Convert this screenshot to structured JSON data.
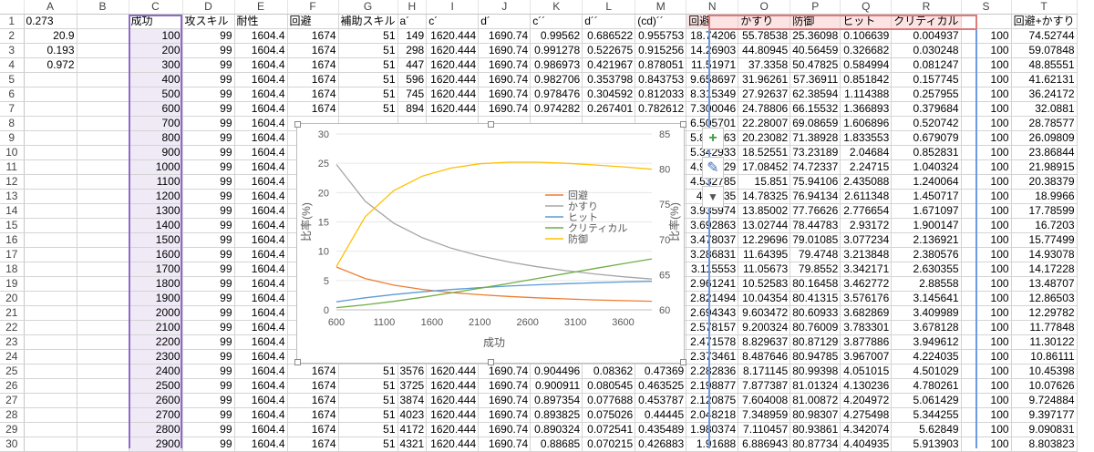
{
  "columns": [
    "A",
    "B",
    "C",
    "D",
    "E",
    "F",
    "G",
    "H",
    "I",
    "J",
    "K",
    "L",
    "M",
    "N",
    "O",
    "P",
    "Q",
    "R",
    "S",
    "T"
  ],
  "rows": [
    [
      "0.273",
      "",
      "成功",
      "攻スキル",
      "耐性",
      "回避",
      "補助スキル",
      "a´",
      "c´",
      "d´",
      "c´´",
      "d´´",
      "(cd)´´",
      "回避",
      "かすり",
      "防御",
      "ヒット",
      "クリティカル",
      "",
      "回避+かすり"
    ],
    [
      "20.9",
      "",
      "100",
      "99",
      "1604.4",
      "1674",
      "51",
      "149",
      "1620.444",
      "1690.74",
      "0.99562",
      "0.686522",
      "0.955753",
      "18.74206",
      "55.78538",
      "25.36098",
      "0.106639",
      "0.004937",
      "100",
      "74.52744"
    ],
    [
      "0.193",
      "",
      "200",
      "99",
      "1604.4",
      "1674",
      "51",
      "298",
      "1620.444",
      "1690.74",
      "0.991278",
      "0.522675",
      "0.915256",
      "14.26903",
      "44.80945",
      "40.56459",
      "0.326682",
      "0.030248",
      "100",
      "59.07848"
    ],
    [
      "0.972",
      "",
      "300",
      "99",
      "1604.4",
      "1674",
      "51",
      "447",
      "1620.444",
      "1690.74",
      "0.986973",
      "0.421967",
      "0.878051",
      "11.51971",
      "37.3358",
      "50.47825",
      "0.584994",
      "0.081247",
      "100",
      "48.85551"
    ],
    [
      "",
      "",
      "400",
      "99",
      "1604.4",
      "1674",
      "51",
      "596",
      "1620.444",
      "1690.74",
      "0.982706",
      "0.353798",
      "0.843753",
      "9.658697",
      "31.96261",
      "57.36911",
      "0.851842",
      "0.157745",
      "100",
      "41.62131"
    ],
    [
      "",
      "",
      "500",
      "99",
      "1604.4",
      "1674",
      "51",
      "745",
      "1620.444",
      "1690.74",
      "0.978476",
      "0.304592",
      "0.812033",
      "8.315349",
      "27.92637",
      "62.38594",
      "1.114388",
      "0.257955",
      "100",
      "36.24172"
    ],
    [
      "",
      "",
      "600",
      "99",
      "1604.4",
      "1674",
      "51",
      "894",
      "1620.444",
      "1690.74",
      "0.974282",
      "0.267401",
      "0.782612",
      "7.300046",
      "24.78806",
      "66.15532",
      "1.366893",
      "0.379684",
      "100",
      "32.0881"
    ],
    [
      "",
      "",
      "700",
      "99",
      "1604.4",
      "",
      "",
      "",
      "",
      "",
      "",
      "",
      "",
      "6.505701",
      "22.28007",
      "69.08659",
      "1.606896",
      "0.520742",
      "100",
      "28.78577"
    ],
    [
      "",
      "",
      "800",
      "99",
      "1604.4",
      "",
      "",
      "",
      "",
      "",
      "",
      "",
      "",
      "5.867263",
      "20.23082",
      "71.38928",
      "1.833553",
      "0.679079",
      "100",
      "26.09809"
    ],
    [
      "",
      "",
      "900",
      "99",
      "1604.4",
      "",
      "",
      "",
      "",
      "",
      "",
      "",
      "",
      "5.342933",
      "18.52551",
      "73.23189",
      "2.04684",
      "0.852831",
      "100",
      "23.86844"
    ],
    [
      "",
      "",
      "1000",
      "99",
      "1604.4",
      "",
      "",
      "",
      "",
      "",
      "",
      "",
      "",
      "4.904629",
      "17.08452",
      "74.72337",
      "2.24715",
      "1.040324",
      "100",
      "21.98915"
    ],
    [
      "",
      "",
      "1100",
      "99",
      "1604.4",
      "",
      "",
      "",
      "",
      "",
      "",
      "",
      "",
      "4.532785",
      "15.851",
      "75.94106",
      "2.435088",
      "1.240064",
      "100",
      "20.38379"
    ],
    [
      "",
      "",
      "1200",
      "99",
      "1604.4",
      "",
      "",
      "",
      "",
      "",
      "",
      "",
      "",
      "4.21335",
      "14.78325",
      "76.94134",
      "2.611348",
      "1.450717",
      "100",
      "18.9966"
    ],
    [
      "",
      "",
      "1300",
      "99",
      "1604.4",
      "",
      "",
      "",
      "",
      "",
      "",
      "",
      "",
      "3.935974",
      "13.85002",
      "77.76626",
      "2.776654",
      "1.671097",
      "100",
      "17.78599"
    ],
    [
      "",
      "",
      "1400",
      "99",
      "1604.4",
      "",
      "",
      "",
      "",
      "",
      "",
      "",
      "",
      "3.692863",
      "13.02744",
      "78.44783",
      "2.93172",
      "1.900147",
      "100",
      "16.7203"
    ],
    [
      "",
      "",
      "1500",
      "99",
      "1604.4",
      "",
      "",
      "",
      "",
      "",
      "",
      "",
      "",
      "3.478037",
      "12.29696",
      "79.01085",
      "3.077234",
      "2.136921",
      "100",
      "15.77499"
    ],
    [
      "",
      "",
      "1600",
      "99",
      "1604.4",
      "",
      "",
      "",
      "",
      "",
      "",
      "",
      "",
      "3.286831",
      "11.64395",
      "79.4748",
      "3.213848",
      "2.380576",
      "100",
      "14.93078"
    ],
    [
      "",
      "",
      "1700",
      "99",
      "1604.4",
      "",
      "",
      "",
      "",
      "",
      "",
      "",
      "",
      "3.115553",
      "11.05673",
      "79.8552",
      "3.342171",
      "2.630355",
      "100",
      "14.17228"
    ],
    [
      "",
      "",
      "1800",
      "99",
      "1604.4",
      "",
      "",
      "",
      "",
      "",
      "",
      "",
      "",
      "2.961241",
      "10.52583",
      "80.16458",
      "3.462772",
      "2.88558",
      "100",
      "13.48707"
    ],
    [
      "",
      "",
      "1900",
      "99",
      "1604.4",
      "",
      "",
      "",
      "",
      "",
      "",
      "",
      "",
      "2.821494",
      "10.04354",
      "80.41315",
      "3.576176",
      "3.145641",
      "100",
      "12.86503"
    ],
    [
      "",
      "",
      "2000",
      "99",
      "1604.4",
      "",
      "",
      "",
      "",
      "",
      "",
      "",
      "",
      "2.694343",
      "9.603472",
      "80.60933",
      "3.682869",
      "3.409989",
      "100",
      "12.29782"
    ],
    [
      "",
      "",
      "2100",
      "99",
      "1604.4",
      "",
      "",
      "",
      "",
      "",
      "",
      "",
      "",
      "2.578157",
      "9.200324",
      "80.76009",
      "3.783301",
      "3.678128",
      "100",
      "11.77848"
    ],
    [
      "",
      "",
      "2200",
      "99",
      "1604.4",
      "",
      "",
      "",
      "",
      "",
      "",
      "",
      "",
      "2.471578",
      "8.829637",
      "80.87129",
      "3.877886",
      "3.949612",
      "100",
      "11.30122"
    ],
    [
      "",
      "",
      "2300",
      "99",
      "1604.4",
      "",
      "",
      "",
      "",
      "",
      "",
      "",
      "",
      "2.373461",
      "8.487646",
      "80.94785",
      "3.967007",
      "4.224035",
      "100",
      "10.86111"
    ],
    [
      "",
      "",
      "2400",
      "99",
      "1604.4",
      "1674",
      "51",
      "3576",
      "1620.444",
      "1690.74",
      "0.904496",
      "0.08362",
      "0.47369",
      "2.282836",
      "8.171145",
      "80.99398",
      "4.051015",
      "4.501029",
      "100",
      "10.45398"
    ],
    [
      "",
      "",
      "2500",
      "99",
      "1604.4",
      "1674",
      "51",
      "3725",
      "1620.444",
      "1690.74",
      "0.900911",
      "0.080545",
      "0.463525",
      "2.198877",
      "7.877387",
      "81.01324",
      "4.130236",
      "4.780261",
      "100",
      "10.07626"
    ],
    [
      "",
      "",
      "2600",
      "99",
      "1604.4",
      "1674",
      "51",
      "3874",
      "1620.444",
      "1690.74",
      "0.897354",
      "0.077688",
      "0.453787",
      "2.120875",
      "7.604008",
      "81.00872",
      "4.204972",
      "5.061429",
      "100",
      "9.724884"
    ],
    [
      "",
      "",
      "2700",
      "99",
      "1604.4",
      "1674",
      "51",
      "4023",
      "1620.444",
      "1690.74",
      "0.893825",
      "0.075026",
      "0.44445",
      "2.048218",
      "7.348959",
      "80.98307",
      "4.275498",
      "5.344255",
      "100",
      "9.397177"
    ],
    [
      "",
      "",
      "2800",
      "99",
      "1604.4",
      "1674",
      "51",
      "4172",
      "1620.444",
      "1690.74",
      "0.890324",
      "0.072541",
      "0.435489",
      "1.980374",
      "7.110457",
      "80.93861",
      "4.342074",
      "5.62849",
      "100",
      "9.090831"
    ],
    [
      "",
      "",
      "2900",
      "99",
      "1604.4",
      "1674",
      "51",
      "4321",
      "1620.444",
      "1690.74",
      "0.88685",
      "0.070215",
      "0.426883",
      "1.91688",
      "6.886943",
      "80.87734",
      "4.404935",
      "5.913903",
      "100",
      "8.803823"
    ]
  ],
  "chart_data": {
    "type": "line",
    "title": "",
    "xlabel": "成功",
    "ylabel_left": "比率(%)",
    "ylabel_right": "比率(%)",
    "x_ticks": [
      "600",
      "1100",
      "1600",
      "2100",
      "2600",
      "3100",
      "3600"
    ],
    "x_range": [
      600,
      3900
    ],
    "ylim_left": [
      0,
      30
    ],
    "ylim_right": [
      60,
      85
    ],
    "y_ticks_left": [
      "0",
      "5",
      "10",
      "15",
      "20",
      "25",
      "30"
    ],
    "y_ticks_right": [
      "60",
      "65",
      "70",
      "75",
      "80",
      "85"
    ],
    "legend_placement": "right-middle",
    "x": [
      600,
      900,
      1200,
      1500,
      1800,
      2100,
      2400,
      2700,
      3000,
      3300,
      3600,
      3900
    ],
    "series": [
      {
        "name": "回避",
        "axis": "left",
        "color": "#ed7d31",
        "values": [
          7.3,
          5.34,
          4.21,
          3.48,
          2.96,
          2.58,
          2.28,
          2.05,
          1.86,
          1.7,
          1.57,
          1.46
        ]
      },
      {
        "name": "かすり",
        "axis": "left",
        "color": "#a5a5a5",
        "values": [
          24.79,
          18.53,
          14.78,
          12.3,
          10.53,
          9.2,
          8.17,
          7.35,
          6.68,
          6.12,
          5.65,
          5.25
        ]
      },
      {
        "name": "ヒット",
        "axis": "left",
        "color": "#5b9bd5",
        "values": [
          1.37,
          2.05,
          2.61,
          3.08,
          3.46,
          3.78,
          4.05,
          4.28,
          4.46,
          4.62,
          4.75,
          4.86
        ]
      },
      {
        "name": "クリティカル",
        "axis": "left",
        "color": "#70ad47",
        "values": [
          0.38,
          0.85,
          1.45,
          2.14,
          2.89,
          3.68,
          4.5,
          5.34,
          6.19,
          7.04,
          7.87,
          8.69
        ]
      },
      {
        "name": "防御",
        "axis": "right",
        "color": "#ffc000",
        "values": [
          66.16,
          73.23,
          76.94,
          79.01,
          80.16,
          80.76,
          80.99,
          80.98,
          80.83,
          80.6,
          80.32,
          79.99
        ]
      }
    ]
  },
  "chart_buttons": {
    "add": "+",
    "style": "✎",
    "filter": "▼"
  }
}
